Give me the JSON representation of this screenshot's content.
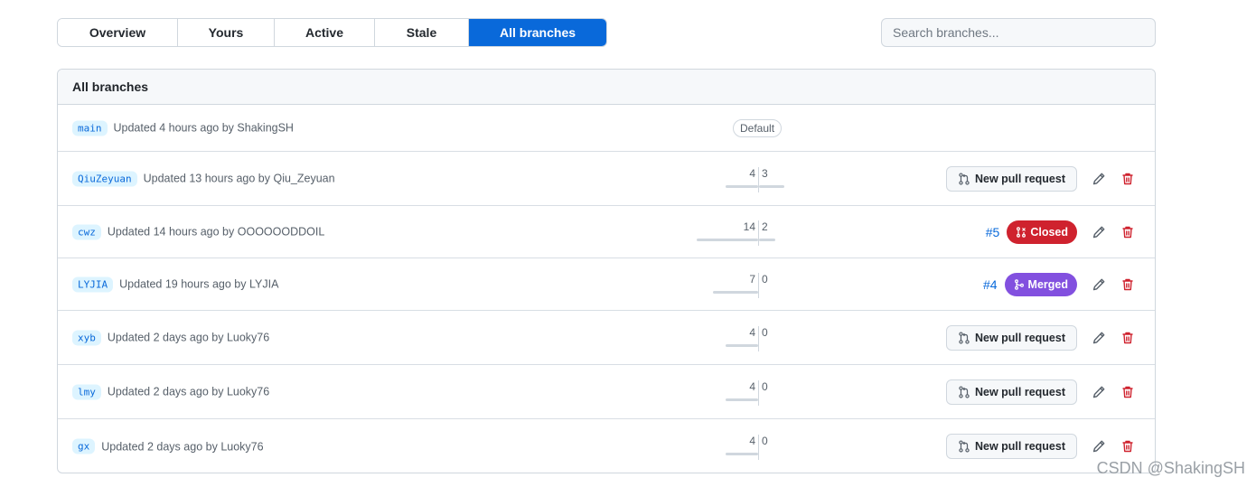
{
  "tabs": [
    {
      "label": "Overview"
    },
    {
      "label": "Yours"
    },
    {
      "label": "Active"
    },
    {
      "label": "Stale"
    },
    {
      "label": "All branches"
    }
  ],
  "search": {
    "placeholder": "Search branches..."
  },
  "box_title": "All branches",
  "default_label": "Default",
  "new_pr_label": "New pull request",
  "rows": [
    {
      "name": "main",
      "updated": "Updated 4 hours ago by",
      "author": "ShakingSH"
    },
    {
      "name": "QiuZeyuan",
      "updated": "Updated 13 hours ago by",
      "author": "Qiu_Zeyuan",
      "behind": "4",
      "ahead": "3"
    },
    {
      "name": "cwz",
      "updated": "Updated 14 hours ago by",
      "author": "OOOOOODDOIL",
      "behind": "14",
      "ahead": "2",
      "pr_number": "#5",
      "pr_state": "Closed"
    },
    {
      "name": "LYJIA",
      "updated": "Updated 19 hours ago by",
      "author": "LYJIA",
      "behind": "7",
      "ahead": "0",
      "pr_number": "#4",
      "pr_state": "Merged"
    },
    {
      "name": "xyb",
      "updated": "Updated 2 days ago by",
      "author": "Luoky76",
      "behind": "4",
      "ahead": "0"
    },
    {
      "name": "lmy",
      "updated": "Updated 2 days ago by",
      "author": "Luoky76",
      "behind": "4",
      "ahead": "0"
    },
    {
      "name": "gx",
      "updated": "Updated 2 days ago by",
      "author": "Luoky76",
      "behind": "4",
      "ahead": "0"
    }
  ],
  "watermark": "CSDN @ShakingSH",
  "colors": {
    "accent": "#0969da",
    "closed": "#cf222e",
    "merged": "#8250df",
    "danger": "#cf222e"
  },
  "icons": [
    "git-pull-request-icon",
    "git-pull-request-closed-icon",
    "git-merge-icon",
    "pencil-icon",
    "trash-icon"
  ]
}
